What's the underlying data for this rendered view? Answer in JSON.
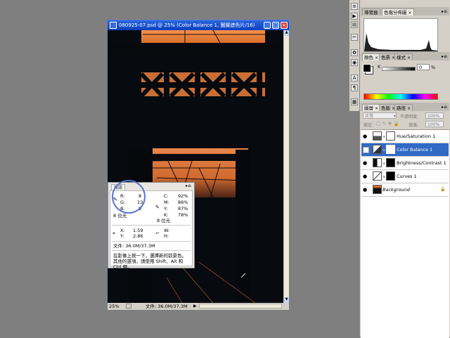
{
  "document": {
    "title": "080925-07.psd @ 25% (Color Balance 1, 圖層遮色片/16)",
    "zoom": "25%",
    "doc_size": "文件: 36.0M/37.3M"
  },
  "info_panel": {
    "tab": "資訊",
    "r_label": "R:",
    "r_value": "8",
    "g_label": "G:",
    "g_value": "13",
    "b_label": "B:",
    "b_value": "9",
    "bits_left": "8 位元",
    "c_label": "C:",
    "c_value": "92%",
    "m_label": "M:",
    "m_value": "86%",
    "y_label": "Y:",
    "y_value": "87%",
    "k_label": "K:",
    "k_value": "78%",
    "bits_right": "8 位元",
    "x_label": "X:",
    "x_value": "1.59",
    "yc_label": "Y:",
    "yc_value": "2.86",
    "w_label": "W:",
    "h_label": "H:",
    "doc_size": "文件: 36.0M/37.3M",
    "hint": "在影像上按一下，選擇新的前景色。其他的選項，請使用 Shift、Alt 和 Ctrl 鍵。"
  },
  "navigator_panel": {
    "tabs": [
      "導覽器",
      "色階分佈圖"
    ]
  },
  "color_panel": {
    "tabs": [
      "顏色",
      "色票",
      "樣式"
    ],
    "k_label": "K",
    "k_value": "0",
    "k_unit": "%"
  },
  "layers_panel": {
    "tabs": [
      "圖層",
      "色版",
      "路徑"
    ],
    "blend_mode": "正常",
    "opacity_label": "不透明度:",
    "opacity_value": "100%",
    "lock_label": "鎖定:",
    "fill_label": "填滿:",
    "fill_value": "100%",
    "layers": [
      {
        "name": "Hue/Saturation 1",
        "visible": true,
        "selected": false
      },
      {
        "name": "Color Balance 1",
        "visible": false,
        "selected": true
      },
      {
        "name": "Brightness/Contrast 1",
        "visible": true,
        "selected": false
      },
      {
        "name": "Curves 1",
        "visible": true,
        "selected": false
      },
      {
        "name": "Background",
        "visible": true,
        "selected": false
      }
    ]
  },
  "colors": {
    "selection": "#316ac5",
    "titlebar": "#0a3fbf",
    "annotation_circle": "#5c78d4"
  },
  "watermark": "#268943"
}
